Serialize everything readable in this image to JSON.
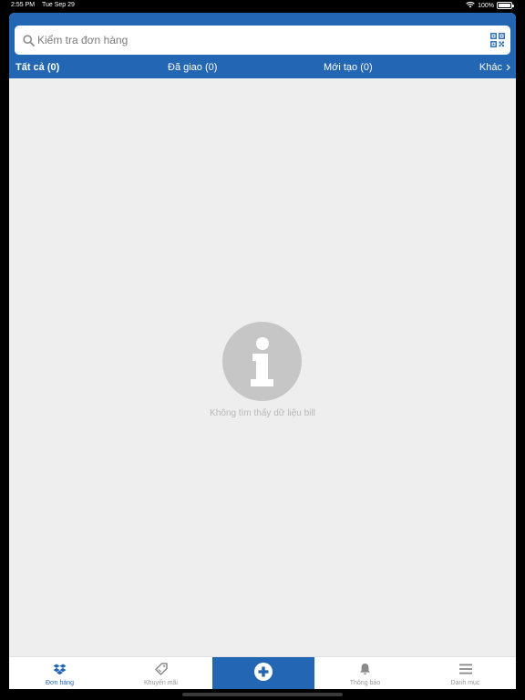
{
  "status_bar": {
    "time": "2:55 PM",
    "date": "Tue Sep 29",
    "battery": "100%"
  },
  "search": {
    "placeholder": "Kiểm tra đơn hàng"
  },
  "tabs": [
    {
      "label": "Tất cả (0)"
    },
    {
      "label": "Đã giao (0)"
    },
    {
      "label": "Mới tạo (0)"
    },
    {
      "label": "Khác"
    }
  ],
  "empty_state": {
    "message": "Không tìm thấy dữ liệu bill"
  },
  "bottom_nav": {
    "orders": "Đơn hàng",
    "promotions": "Khuyến mãi",
    "notifications": "Thông báo",
    "menu": "Danh mục"
  },
  "colors": {
    "brand": "#2366b4",
    "background": "#eeeeee",
    "empty_icon": "#c6c6c6"
  },
  "icons": [
    "search-icon",
    "qr-code-icon",
    "chevron-right-icon",
    "info-icon",
    "dropbox-icon",
    "tag-icon",
    "plus-circle-icon",
    "bell-icon",
    "menu-icon",
    "wifi-icon",
    "battery-icon"
  ]
}
